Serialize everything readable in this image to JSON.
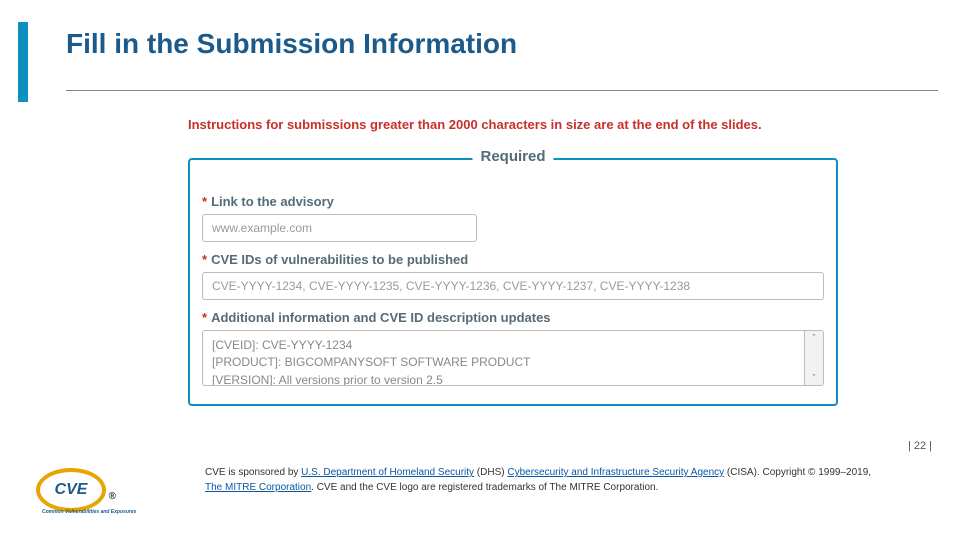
{
  "title": "Fill in the Submission Information",
  "instructions": "Instructions for submissions greater than 2000 characters in size are at the end of the slides.",
  "legend": "Required",
  "asterisk": "*",
  "field1": {
    "label": "Link to the advisory",
    "placeholder": "www.example.com"
  },
  "field2": {
    "label": "CVE IDs of vulnerabilities to be published",
    "placeholder": "CVE-YYYY-1234, CVE-YYYY-1235, CVE-YYYY-1236, CVE-YYYY-1237, CVE-YYYY-1238"
  },
  "field3": {
    "label": "Additional information and CVE ID description updates",
    "line1": "[CVEID]: CVE-YYYY-1234",
    "line2": "[PRODUCT]: BIGCOMPANYSOFT SOFTWARE PRODUCT",
    "line3": "[VERSION]: All versions prior to version 2.5"
  },
  "scroll_up": "ˆ",
  "scroll_down": "ˇ",
  "logo_text": "CVE",
  "logo_reg": "®",
  "logo_sub": "Common Vulnerabilities and Exposures",
  "page_num": "| 22 |",
  "footer": {
    "t1": "CVE is sponsored by ",
    "l1": "U.S. Department of Homeland Security",
    "t2": " (DHS) ",
    "l2": "Cybersecurity and Infrastructure Security Agency",
    "t3": " (CISA). Copyright © 1999–2019, ",
    "l3": "The MITRE Corporation",
    "t4": ". CVE and the CVE logo are registered trademarks of The MITRE Corporation."
  }
}
